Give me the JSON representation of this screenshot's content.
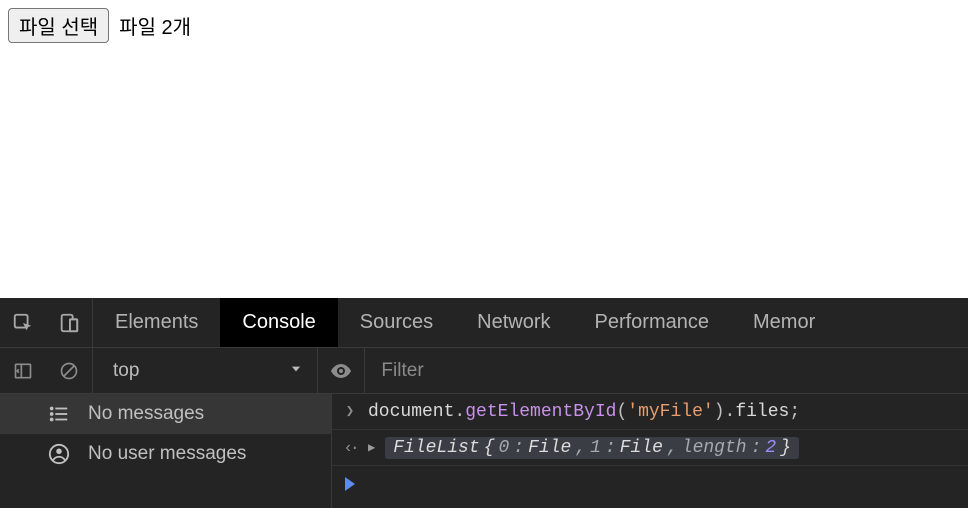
{
  "page": {
    "file_button_label": "파일 선택",
    "file_status": "파일 2개"
  },
  "devtools": {
    "tabs": {
      "elements": "Elements",
      "console": "Console",
      "sources": "Sources",
      "network": "Network",
      "performance": "Performance",
      "memory": "Memor"
    },
    "toolbar": {
      "context": "top",
      "filter_placeholder": "Filter"
    },
    "sidebar": {
      "no_messages": "No messages",
      "no_user_messages": "No user messages"
    },
    "console": {
      "input_code": {
        "p1": "document",
        "p2": ".",
        "p3": "getElementById",
        "p4": "(",
        "p5": "'myFile'",
        "p6": ")",
        "p7": ".",
        "p8": "files",
        "p9": ";"
      },
      "output": {
        "class_name": "FileList",
        "lbrace": " {",
        "k0": "0",
        "sep": ": ",
        "v_file": "File",
        "comma": ", ",
        "k1": "1",
        "k_len": "length",
        "v_len": "2",
        "rbrace": "}"
      }
    }
  }
}
